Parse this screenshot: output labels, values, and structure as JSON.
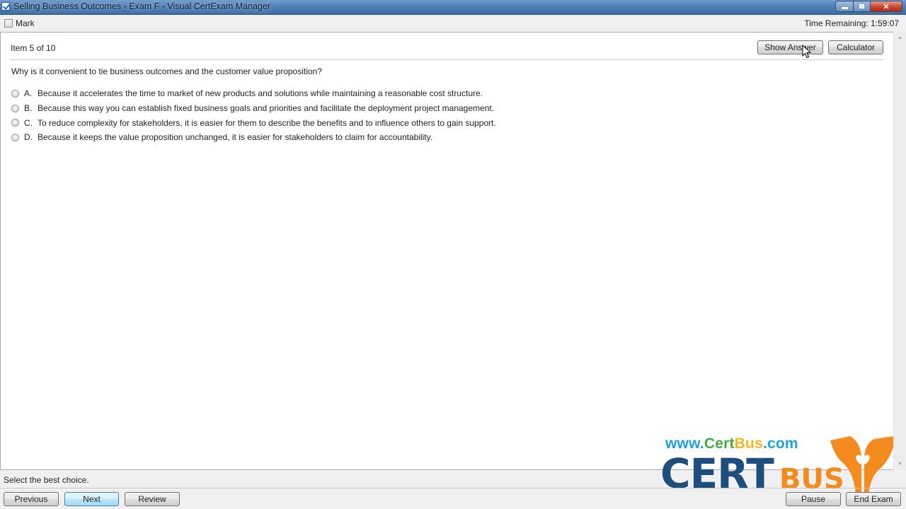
{
  "window": {
    "title": "Selling Business Outcomes - Exam F - Visual CertExam Manager",
    "controls": {
      "minimize": "minimize-icon",
      "maximize": "maximize-icon",
      "close": "✕"
    }
  },
  "topbar": {
    "mark_label": "Mark",
    "mark_checked": false,
    "time_remaining": "Time Remaining: 1:59:07"
  },
  "question_panel": {
    "item_label": "Item 5 of 10",
    "show_answer_label": "Show Answer",
    "calculator_label": "Calculator",
    "question": "Why is it convenient to tie business outcomes and the customer value proposition?",
    "options": [
      {
        "letter": "A.",
        "text": "Because it accelerates the time to market of new products and solutions while maintaining a reasonable cost structure.",
        "selected": false
      },
      {
        "letter": "B.",
        "text": "Because this way you can establish fixed business goals and priorities and facilitate the deployment project management.",
        "selected": false
      },
      {
        "letter": "C.",
        "text": "To reduce complexity for stakeholders, it is easier for them to describe the benefits and to influence others to gain support.",
        "selected": false
      },
      {
        "letter": "D.",
        "text": "Because it keeps the value proposition unchanged, it is easier for stakeholders to claim for accountability.",
        "selected": false
      }
    ]
  },
  "watermark": {
    "url_parts": [
      {
        "text": "www.",
        "color": "#1aa3e0"
      },
      {
        "text": "Cert",
        "color": "#3cae3c"
      },
      {
        "text": "Bus",
        "color": "#f5b51f"
      },
      {
        "text": ".com",
        "color": "#1aa3e0"
      }
    ],
    "brand_primary": "CERT",
    "brand_secondary": "BUS",
    "colors": {
      "primary": "#1d4e7d",
      "secondary": "#f58b1f"
    }
  },
  "status": {
    "instruction": "Select the best choice."
  },
  "footer": {
    "previous_label": "Previous",
    "next_label": "Next",
    "review_label": "Review",
    "pause_label": "Pause",
    "end_exam_label": "End Exam"
  }
}
